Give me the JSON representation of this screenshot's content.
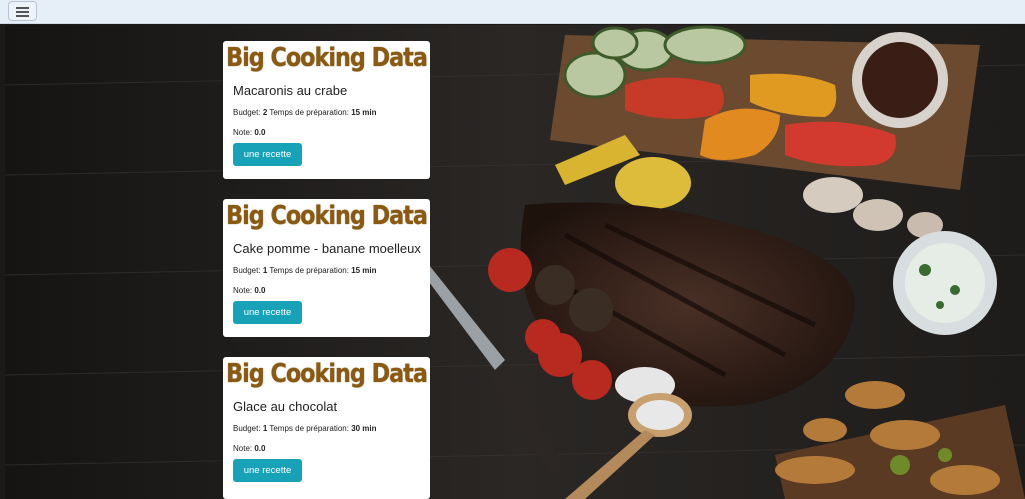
{
  "nav": {
    "menu_icon": "hamburger-icon"
  },
  "background": {
    "description_icon": "food-board-image"
  },
  "recipes": [
    {
      "logo": "Big Cooking Data",
      "title": "Macaronis au crabe",
      "budget_label": "Budget:",
      "budget": "2",
      "time_label": "Temps de préparation:",
      "time": "15 min",
      "note_label": "Note:",
      "note": "0.0",
      "button": "une recette"
    },
    {
      "logo": "Big Cooking Data",
      "title": "Cake pomme - banane moelleux",
      "budget_label": "Budget:",
      "budget": "1",
      "time_label": "Temps de préparation:",
      "time": "15 min",
      "note_label": "Note:",
      "note": "0.0",
      "button": "une recette"
    },
    {
      "logo": "Big Cooking Data",
      "title": "Glace au chocolat",
      "budget_label": "Budget:",
      "budget": "1",
      "time_label": "Temps de préparation:",
      "time": "30 min",
      "note_label": "Note:",
      "note": "0.0",
      "button": "une recette"
    }
  ],
  "colors": {
    "accent_button": "#17a2b8",
    "logo": "#8a5a12",
    "navbar": "#e6eef8"
  }
}
